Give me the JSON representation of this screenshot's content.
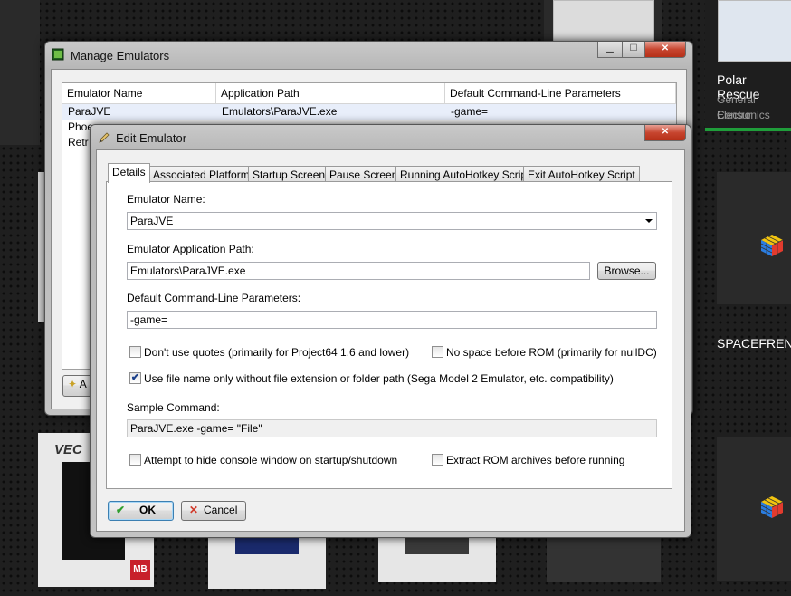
{
  "background": {
    "tiles": [
      {
        "title": "Polar Rescue",
        "publisher_line1": "General Consur",
        "publisher_line2": "Electronics"
      },
      {
        "title": "SPACEFRENZ"
      }
    ],
    "accent_green": "#1f9d3a"
  },
  "manage_window": {
    "title": "Manage Emulators",
    "columns": [
      "Emulator Name",
      "Application Path",
      "Default Command-Line Parameters"
    ],
    "rows": [
      {
        "name": "ParaJVE",
        "path": "Emulators\\ParaJVE.exe",
        "params": "-game="
      },
      {
        "name": "Phoe",
        "path": "",
        "params": ""
      },
      {
        "name": "Retr",
        "path": "",
        "params": ""
      }
    ],
    "add_button_partial": "A"
  },
  "edit_window": {
    "title": "Edit Emulator",
    "tabs": [
      "Details",
      "Associated Platforms",
      "Startup Screen",
      "Pause Screen",
      "Running AutoHotkey Script",
      "Exit AutoHotkey Script"
    ],
    "emulator_name_label": "Emulator Name:",
    "emulator_name_value": "ParaJVE",
    "app_path_label": "Emulator Application Path:",
    "app_path_value": "Emulators\\ParaJVE.exe",
    "browse_label": "Browse...",
    "params_label": "Default Command-Line Parameters:",
    "params_value": "-game=",
    "dont_use_quotes_label": "Don't use quotes (primarily for Project64 1.6 and lower)",
    "dont_use_quotes_checked": false,
    "no_space_label": "No space before ROM (primarily for nullDC)",
    "no_space_checked": false,
    "use_file_name_label": "Use file name only without file extension or folder path (Sega Model 2 Emulator, etc. compatibility)",
    "use_file_name_checked": true,
    "sample_command_label": "Sample Command:",
    "sample_command_value": "ParaJVE.exe -game= \"File\"",
    "hide_console_label": "Attempt to hide console window on startup/shutdown",
    "hide_console_checked": false,
    "extract_rom_label": "Extract ROM archives before running",
    "extract_rom_checked": false,
    "ok_label": "OK",
    "cancel_label": "Cancel"
  }
}
